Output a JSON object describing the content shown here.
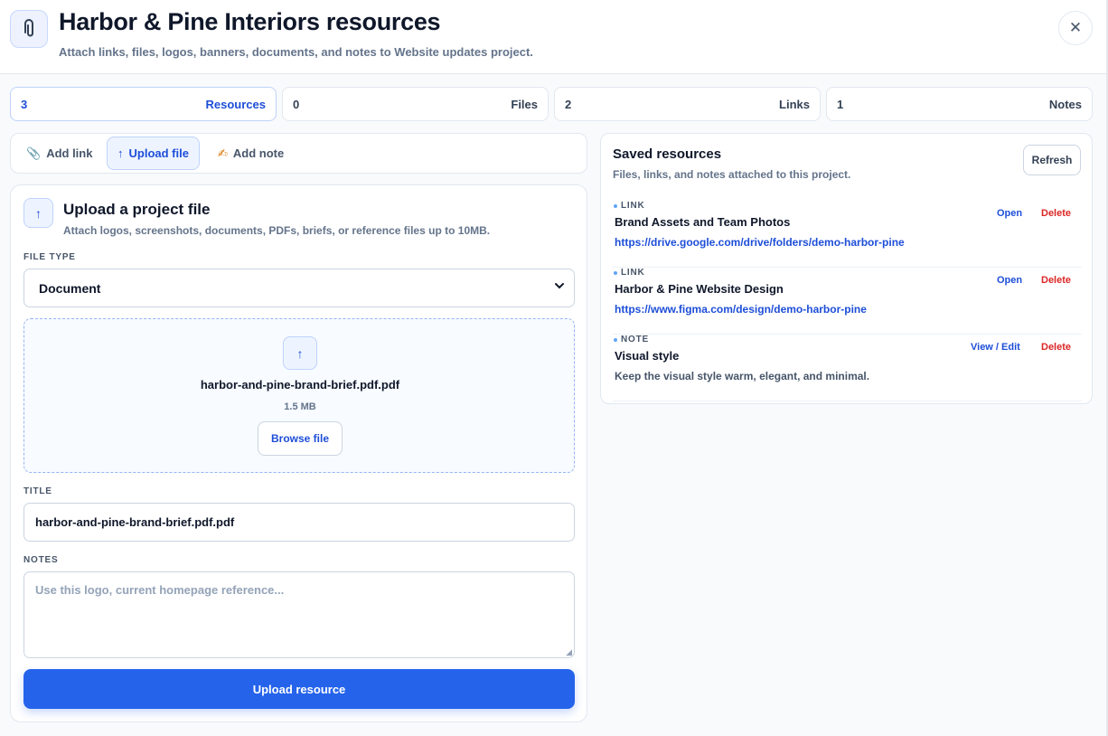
{
  "header": {
    "icon": "paperclip-icon",
    "title": "Harbor & Pine Interiors resources",
    "subtitle": "Attach links, files, logos, banners, documents, and notes to Website updates project.",
    "close_glyph": "✕"
  },
  "stats": [
    {
      "count": "3",
      "label": "Resources",
      "active": true
    },
    {
      "count": "0",
      "label": "Files",
      "active": false
    },
    {
      "count": "2",
      "label": "Links",
      "active": false
    },
    {
      "count": "1",
      "label": "Notes",
      "active": false
    }
  ],
  "tabs": [
    {
      "label": "Add link",
      "icon": "paperclip-icon",
      "glyph": "📎",
      "active": false
    },
    {
      "label": "Upload file",
      "icon": "arrow-up-icon",
      "glyph": "↑",
      "active": true
    },
    {
      "label": "Add note",
      "icon": "pencil-note-icon",
      "glyph": "✍",
      "active": false
    }
  ],
  "upload": {
    "icon_glyph": "↑",
    "title": "Upload a project file",
    "description": "Attach logos, screenshots, documents, PDFs, briefs, or reference files up to 10MB.",
    "file_type_label": "FILE TYPE",
    "file_type_value": "Document",
    "chevron": "⌄",
    "selected_file_name": "harbor-and-pine-brand-brief.pdf.pdf",
    "selected_file_size": "1.5 MB",
    "browse_label": "Browse file",
    "title_label": "TITLE",
    "title_value": "harbor-and-pine-brand-brief.pdf.pdf",
    "notes_label": "NOTES",
    "notes_placeholder": "Use this logo, current homepage reference...",
    "submit_label": "Upload resource"
  },
  "saved": {
    "title": "Saved resources",
    "description": "Files, links, and notes attached to this project.",
    "refresh_label": "Refresh",
    "items": [
      {
        "type": "LINK",
        "title": "Brand Assets and Team Photos",
        "detail": "https://drive.google.com/drive/folders/demo-harbor-pine",
        "action": "Open",
        "delete": "Delete"
      },
      {
        "type": "LINK",
        "title": "Harbor & Pine Website Design",
        "detail": "https://www.figma.com/design/demo-harbor-pine",
        "action": "Open",
        "delete": "Delete"
      },
      {
        "type": "NOTE",
        "title": "Visual style",
        "detail": "Keep the visual style warm, elegant, and minimal.",
        "action": "View / Edit",
        "delete": "Delete"
      }
    ]
  },
  "colors": {
    "accent": "#2563eb",
    "accent_text": "#1d4ed8",
    "danger": "#dc2626",
    "background": "#f8fafc"
  }
}
